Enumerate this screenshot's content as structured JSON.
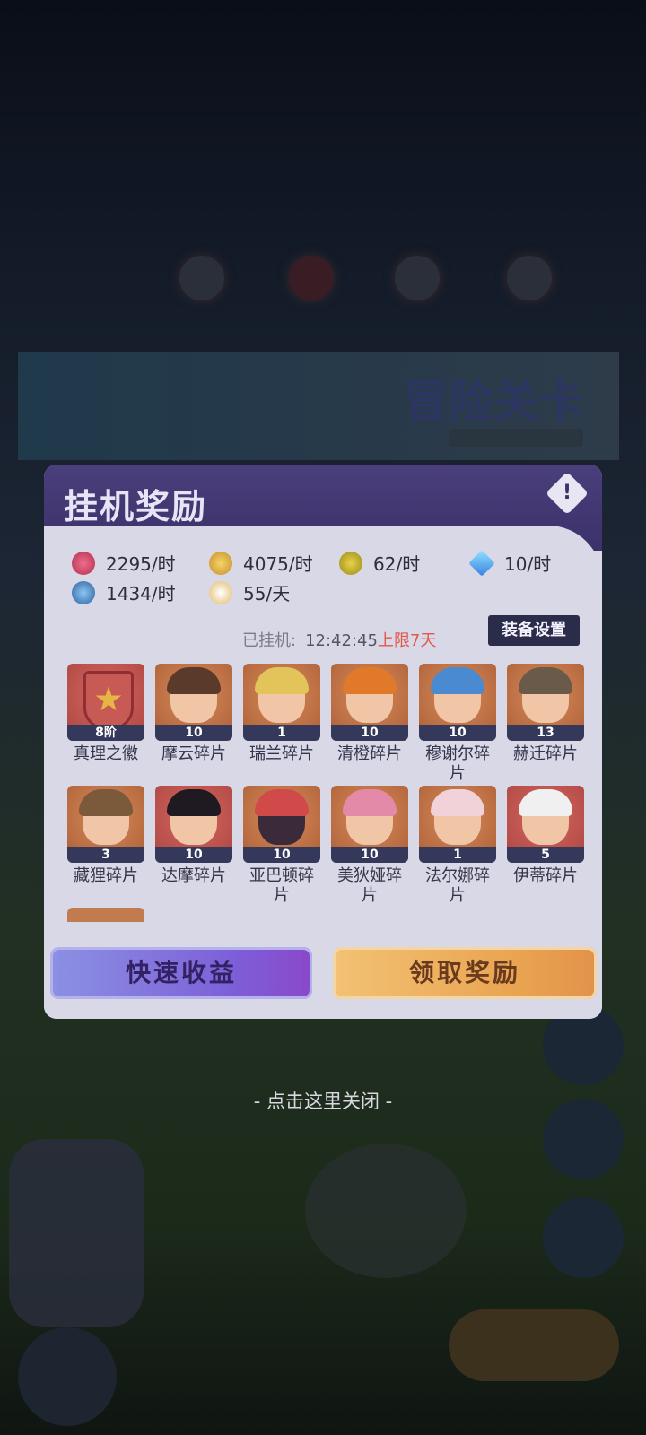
{
  "background": {
    "banner_title": "冒险关卡"
  },
  "panel": {
    "title": "挂机奖励",
    "info_icon": "alert-diamond-icon"
  },
  "rates": [
    {
      "icon": "red-orb-icon",
      "color": "#d04a6a",
      "text": "2295/时"
    },
    {
      "icon": "gold-coin-icon",
      "color": "#e0b44a",
      "text": "4075/时"
    },
    {
      "icon": "exp-feather-icon",
      "color": "#c9b22a",
      "text": "62/时"
    },
    {
      "icon": "diamond-icon",
      "color": "#4aa8e6",
      "text": "10/时"
    },
    {
      "icon": "blue-crystal-icon",
      "color": "#3f7fc8",
      "text": "1434/时"
    },
    {
      "icon": "white-orb-icon",
      "color": "#e8c27a",
      "text": "55/天"
    }
  ],
  "idle": {
    "label": "已挂机:",
    "time": "12:42:45",
    "limit": "上限7天"
  },
  "equip_button": "装备设置",
  "items_row1": [
    {
      "name": "真理之徽",
      "count": "8阶"
    },
    {
      "name": "摩云碎片",
      "count": "10"
    },
    {
      "name": "瑞兰碎片",
      "count": "1"
    },
    {
      "name": "清橙碎片",
      "count": "10"
    },
    {
      "name": "穆谢尔碎片",
      "count": "10"
    },
    {
      "name": "赫迁碎片",
      "count": "13"
    }
  ],
  "items_row2": [
    {
      "name": "藏狸碎片",
      "count": "3"
    },
    {
      "name": "达摩碎片",
      "count": "10"
    },
    {
      "name": "亚巴顿碎片",
      "count": "10"
    },
    {
      "name": "美狄娅碎片",
      "count": "10"
    },
    {
      "name": "法尔娜碎片",
      "count": "1"
    },
    {
      "name": "伊蒂碎片",
      "count": "5"
    }
  ],
  "buttons": {
    "fast": "快速收益",
    "claim": "领取奖励"
  },
  "close_hint": "- 点击这里关闭 -"
}
